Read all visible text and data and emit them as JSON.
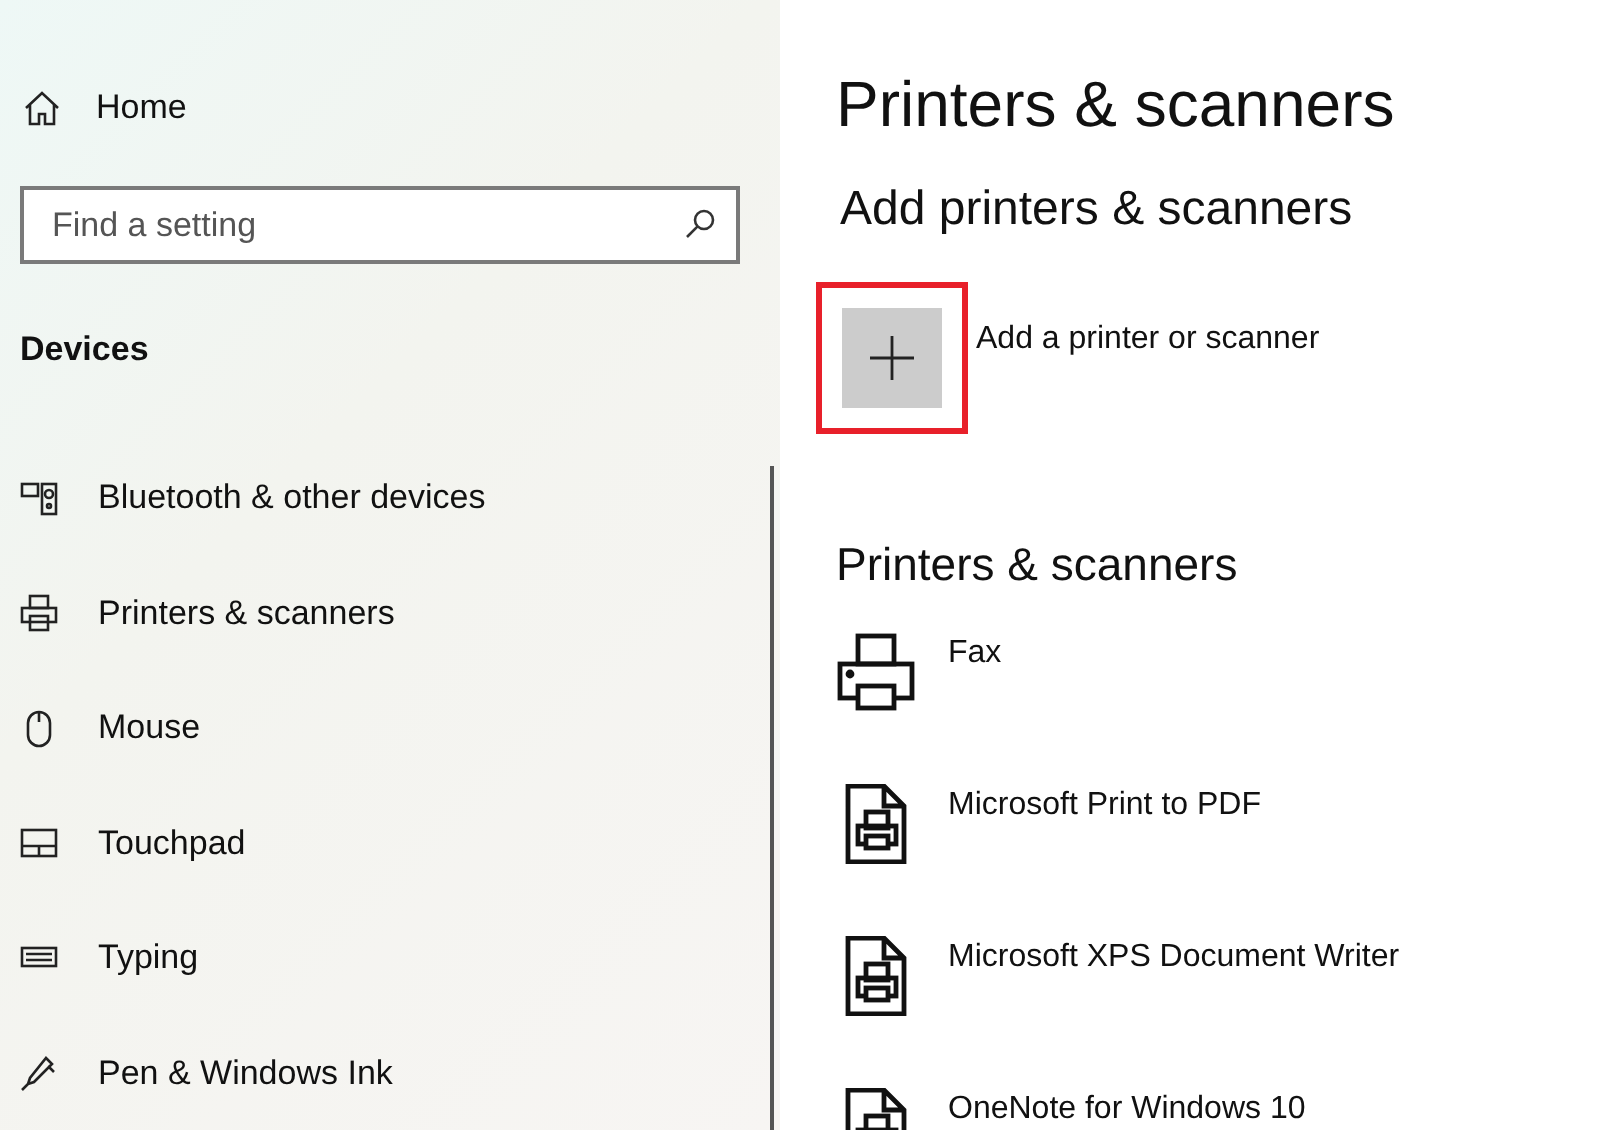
{
  "sidebar": {
    "home": "Home",
    "search": {
      "placeholder": "Find a setting"
    },
    "section": "Devices",
    "items": [
      {
        "label": "Bluetooth & other devices"
      },
      {
        "label": "Printers & scanners"
      },
      {
        "label": "Mouse"
      },
      {
        "label": "Touchpad"
      },
      {
        "label": "Typing"
      },
      {
        "label": "Pen & Windows Ink"
      }
    ]
  },
  "main": {
    "title": "Printers & scanners",
    "add_heading": "Add printers & scanners",
    "add_button": {
      "label": "Add a printer or scanner",
      "highlighted": true
    },
    "list_heading": "Printers & scanners",
    "printers": [
      {
        "name": "Fax",
        "kind": "printer"
      },
      {
        "name": "Microsoft Print to PDF",
        "kind": "document"
      },
      {
        "name": "Microsoft XPS Document Writer",
        "kind": "document"
      },
      {
        "name": "OneNote for Windows 10",
        "kind": "document"
      }
    ]
  }
}
